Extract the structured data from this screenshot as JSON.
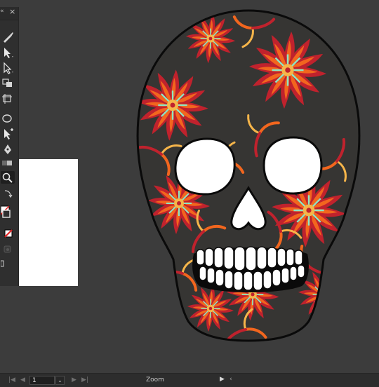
{
  "tools_panel": {
    "collapse_glyph": "«",
    "close_glyph": "×",
    "tools": [
      {
        "name": "paintbrush-icon"
      },
      {
        "name": "selection-arrow-icon"
      },
      {
        "name": "direct-selection-icon"
      },
      {
        "name": "shape-builder-icon"
      },
      {
        "name": "artboard-icon"
      },
      {
        "name": "ellipse-icon"
      },
      {
        "name": "anchor-point-icon"
      },
      {
        "name": "pen-icon"
      },
      {
        "name": "gradient-icon"
      },
      {
        "name": "zoom-icon"
      },
      {
        "name": "swap-colors-icon"
      },
      {
        "name": "fill-stroke-icon"
      },
      {
        "name": "none-swatch-icon"
      },
      {
        "name": "draw-mode-icon"
      },
      {
        "name": "screen-mode-icon"
      }
    ]
  },
  "status_bar": {
    "first_glyph": "|◀",
    "prev_glyph": "◀",
    "page_number": "1",
    "dropdown_glyph": "⌄",
    "next_glyph": "▶",
    "last_glyph": "▶|",
    "zoom_label": "Zoom",
    "play_glyph": "▶",
    "back_glyph": "‹"
  },
  "colors": {
    "canvas_bg": "#3c3c3c",
    "skull_bg": "#363533",
    "pattern_red": "#c0222d",
    "pattern_orange": "#f2661e",
    "pattern_yellow": "#f6b54a",
    "pattern_mint": "#8de6c4"
  }
}
